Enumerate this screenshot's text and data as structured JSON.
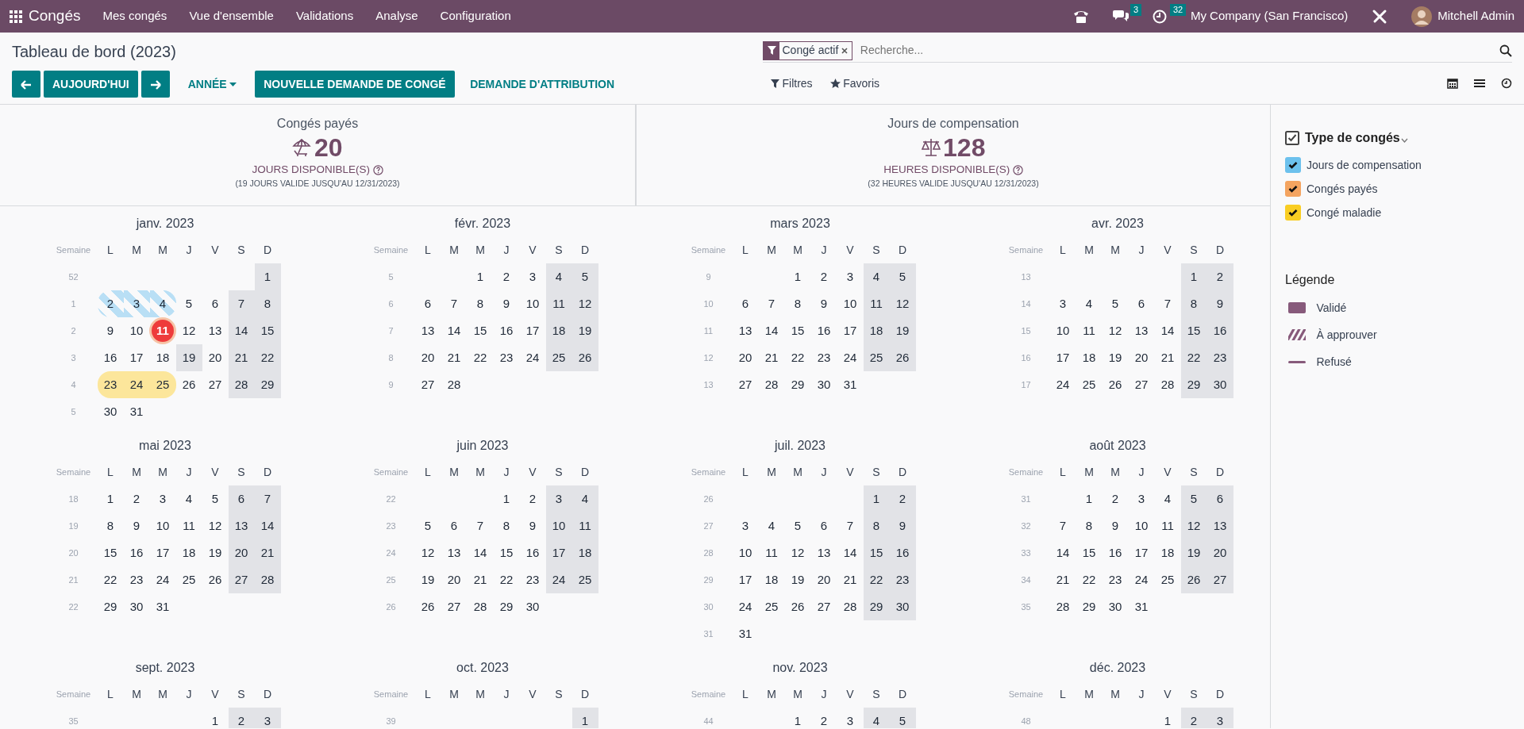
{
  "navbar": {
    "app": "Congés",
    "menu": [
      "Mes congés",
      "Vue d'ensemble",
      "Validations",
      "Analyse",
      "Configuration"
    ],
    "chat_count": "3",
    "activity_count": "32",
    "company": "My Company (San Francisco)",
    "user": "Mitchell Admin"
  },
  "breadcrumb": "Tableau de bord (2023)",
  "search": {
    "facet": "Congé actif",
    "placeholder": "Recherche..."
  },
  "toolbar": {
    "today": "AUJOURD'HUI",
    "period": "ANNÉE",
    "primary": "NOUVELLE DEMANDE DE CONGÉ",
    "secondary": "DEMANDE D'ATTRIBUTION",
    "filters": "Filtres",
    "favorites": "Favoris"
  },
  "views": [
    {
      "kind": "calendar"
    },
    {
      "kind": "list"
    },
    {
      "kind": "activity"
    }
  ],
  "summaries": [
    {
      "kind": "umbrella",
      "title": "Congés payés",
      "value": "20",
      "unit": "JOURS DISPONIBLE(S)",
      "note": "(19 JOURS VALIDE JUSQU'AU 12/31/2023)"
    },
    {
      "kind": "scale",
      "title": "Jours de compensation",
      "value": "128",
      "unit": "HEURES DISPONIBLE(S)",
      "note": "(32 HEURES VALIDE JUSQU'AU 12/31/2023)"
    }
  ],
  "calendar": {
    "weekend": [
      false,
      false,
      false,
      false,
      false,
      true,
      true
    ],
    "months": [
      {
        "title": "janv. 2023",
        "week_label": "Semaine",
        "weekdays": [
          "L",
          "M",
          "M",
          "J",
          "V",
          "S",
          "D"
        ],
        "weeks": [
          {
            "week": "52",
            "partial_start": true,
            "days": [
              "1"
            ]
          },
          {
            "week": "1",
            "days": [
              {
                "text": "2",
                "kind": "to_approve",
                "color": "#b9dff5"
              },
              {
                "text": "3",
                "kind": "to_approve",
                "color": "#b9dff5"
              },
              {
                "text": "4",
                "kind": "to_approve",
                "color": "#b9dff5"
              },
              "5",
              "6",
              "7",
              "8"
            ]
          },
          {
            "week": "2",
            "days": [
              "9",
              "10",
              {
                "text": "11",
                "today": true
              },
              "12",
              "13",
              "14",
              "15"
            ]
          },
          {
            "week": "3",
            "days": [
              "16",
              "17",
              "18",
              {
                "text": "19",
                "holiday": true
              },
              "20",
              "21",
              "22"
            ]
          },
          {
            "week": "4",
            "days": [
              {
                "text": "23",
                "kind": "validated",
                "color": "#fce69b"
              },
              {
                "text": "24",
                "kind": "validated",
                "color": "#fce69b"
              },
              {
                "text": "25",
                "kind": "validated",
                "color": "#fce69b"
              },
              "26",
              "27",
              "28",
              "29"
            ]
          },
          {
            "week": "5",
            "days": [
              "30",
              "31"
            ]
          }
        ]
      },
      {
        "title": "févr. 2023",
        "week_label": "Semaine",
        "weekdays": [
          "L",
          "M",
          "M",
          "J",
          "V",
          "S",
          "D"
        ],
        "weeks": [
          {
            "week": "5",
            "partial_start": true,
            "days": [
              "1",
              "2",
              "3",
              "4",
              "5"
            ]
          },
          {
            "week": "6",
            "days": [
              "6",
              "7",
              "8",
              "9",
              "10",
              "11",
              "12"
            ]
          },
          {
            "week": "7",
            "days": [
              "13",
              "14",
              "15",
              "16",
              "17",
              "18",
              "19"
            ]
          },
          {
            "week": "8",
            "days": [
              "20",
              "21",
              "22",
              "23",
              "24",
              "25",
              "26"
            ]
          },
          {
            "week": "9",
            "days": [
              "27",
              "28"
            ]
          }
        ]
      },
      {
        "title": "mars 2023",
        "week_label": "Semaine",
        "weekdays": [
          "L",
          "M",
          "M",
          "J",
          "V",
          "S",
          "D"
        ],
        "weeks": [
          {
            "week": "9",
            "partial_start": true,
            "days": [
              "1",
              "2",
              "3",
              "4",
              "5"
            ]
          },
          {
            "week": "10",
            "days": [
              "6",
              "7",
              "8",
              "9",
              "10",
              "11",
              "12"
            ]
          },
          {
            "week": "11",
            "days": [
              "13",
              "14",
              "15",
              "16",
              "17",
              "18",
              "19"
            ]
          },
          {
            "week": "12",
            "days": [
              "20",
              "21",
              "22",
              "23",
              "24",
              "25",
              "26"
            ]
          },
          {
            "week": "13",
            "days": [
              "27",
              "28",
              "29",
              "30",
              "31"
            ]
          }
        ]
      },
      {
        "title": "avr. 2023",
        "week_label": "Semaine",
        "weekdays": [
          "L",
          "M",
          "M",
          "J",
          "V",
          "S",
          "D"
        ],
        "weeks": [
          {
            "week": "13",
            "partial_start": true,
            "days": [
              "1",
              "2"
            ]
          },
          {
            "week": "14",
            "days": [
              "3",
              "4",
              "5",
              "6",
              "7",
              "8",
              "9"
            ]
          },
          {
            "week": "15",
            "days": [
              "10",
              "11",
              "12",
              "13",
              "14",
              "15",
              "16"
            ]
          },
          {
            "week": "16",
            "days": [
              "17",
              "18",
              "19",
              "20",
              "21",
              "22",
              "23"
            ]
          },
          {
            "week": "17",
            "days": [
              "24",
              "25",
              "26",
              "27",
              "28",
              "29",
              "30"
            ]
          }
        ]
      },
      {
        "title": "mai 2023",
        "week_label": "Semaine",
        "weekdays": [
          "L",
          "M",
          "M",
          "J",
          "V",
          "S",
          "D"
        ],
        "weeks": [
          {
            "week": "18",
            "days": [
              "1",
              "2",
              "3",
              "4",
              "5",
              "6",
              "7"
            ]
          },
          {
            "week": "19",
            "days": [
              "8",
              "9",
              "10",
              "11",
              "12",
              "13",
              "14"
            ]
          },
          {
            "week": "20",
            "days": [
              "15",
              "16",
              "17",
              "18",
              "19",
              "20",
              "21"
            ]
          },
          {
            "week": "21",
            "days": [
              "22",
              "23",
              "24",
              "25",
              "26",
              "27",
              "28"
            ]
          },
          {
            "week": "22",
            "days": [
              "29",
              "30",
              "31"
            ]
          }
        ]
      },
      {
        "title": "juin 2023",
        "week_label": "Semaine",
        "weekdays": [
          "L",
          "M",
          "M",
          "J",
          "V",
          "S",
          "D"
        ],
        "weeks": [
          {
            "week": "22",
            "partial_start": true,
            "days": [
              "1",
              "2",
              "3",
              "4"
            ]
          },
          {
            "week": "23",
            "days": [
              "5",
              "6",
              "7",
              "8",
              "9",
              "10",
              "11"
            ]
          },
          {
            "week": "24",
            "days": [
              "12",
              "13",
              "14",
              "15",
              "16",
              "17",
              "18"
            ]
          },
          {
            "week": "25",
            "days": [
              "19",
              "20",
              "21",
              "22",
              "23",
              "24",
              "25"
            ]
          },
          {
            "week": "26",
            "days": [
              "26",
              "27",
              "28",
              "29",
              "30"
            ]
          }
        ]
      },
      {
        "title": "juil. 2023",
        "week_label": "Semaine",
        "weekdays": [
          "L",
          "M",
          "M",
          "J",
          "V",
          "S",
          "D"
        ],
        "weeks": [
          {
            "week": "26",
            "partial_start": true,
            "days": [
              "1",
              "2"
            ]
          },
          {
            "week": "27",
            "days": [
              "3",
              "4",
              "5",
              "6",
              "7",
              "8",
              "9"
            ]
          },
          {
            "week": "28",
            "days": [
              "10",
              "11",
              "12",
              "13",
              "14",
              "15",
              "16"
            ]
          },
          {
            "week": "29",
            "days": [
              "17",
              "18",
              "19",
              "20",
              "21",
              "22",
              "23"
            ]
          },
          {
            "week": "30",
            "days": [
              "24",
              "25",
              "26",
              "27",
              "28",
              "29",
              "30"
            ]
          },
          {
            "week": "31",
            "days": [
              "31"
            ]
          }
        ]
      },
      {
        "title": "août 2023",
        "week_label": "Semaine",
        "weekdays": [
          "L",
          "M",
          "M",
          "J",
          "V",
          "S",
          "D"
        ],
        "weeks": [
          {
            "week": "31",
            "partial_start": true,
            "days": [
              "1",
              "2",
              "3",
              "4",
              "5",
              "6"
            ]
          },
          {
            "week": "32",
            "days": [
              "7",
              "8",
              "9",
              "10",
              "11",
              "12",
              "13"
            ]
          },
          {
            "week": "33",
            "days": [
              "14",
              "15",
              "16",
              "17",
              "18",
              "19",
              "20"
            ]
          },
          {
            "week": "34",
            "days": [
              "21",
              "22",
              "23",
              "24",
              "25",
              "26",
              "27"
            ]
          },
          {
            "week": "35",
            "days": [
              "28",
              "29",
              "30",
              "31"
            ]
          }
        ]
      },
      {
        "title": "sept. 2023",
        "week_label": "Semaine",
        "weekdays": [
          "L",
          "M",
          "M",
          "J",
          "V",
          "S",
          "D"
        ],
        "weeks": [
          {
            "week": "35",
            "partial_start": true,
            "days": [
              "1",
              "2",
              "3"
            ]
          }
        ]
      },
      {
        "title": "oct. 2023",
        "week_label": "Semaine",
        "weekdays": [
          "L",
          "M",
          "M",
          "J",
          "V",
          "S",
          "D"
        ],
        "weeks": [
          {
            "week": "39",
            "partial_start": true,
            "days": [
              "1"
            ]
          }
        ]
      },
      {
        "title": "nov. 2023",
        "week_label": "Semaine",
        "weekdays": [
          "L",
          "M",
          "M",
          "J",
          "V",
          "S",
          "D"
        ],
        "weeks": [
          {
            "week": "44",
            "partial_start": true,
            "days": [
              "1",
              "2",
              "3",
              "4",
              "5"
            ]
          }
        ]
      },
      {
        "title": "déc. 2023",
        "week_label": "Semaine",
        "weekdays": [
          "L",
          "M",
          "M",
          "J",
          "V",
          "S",
          "D"
        ],
        "weeks": [
          {
            "week": "48",
            "partial_start": true,
            "days": [
              "1",
              "2",
              "3"
            ]
          }
        ]
      }
    ]
  },
  "filter": {
    "title": "Type de congés",
    "checked": true,
    "items": [
      {
        "label": "Jours de compensation",
        "checked": true,
        "color": "#6cc1ed"
      },
      {
        "label": "Congés payés",
        "checked": true,
        "color": "#f4a460"
      },
      {
        "label": "Congé maladie",
        "checked": true,
        "color": "#f9cd23"
      }
    ]
  },
  "legend": {
    "title": "Légende",
    "items": [
      {
        "kind": "validated",
        "label": "Validé"
      },
      {
        "kind": "to_approve",
        "label": "À approuver"
      },
      {
        "kind": "refused",
        "label": "Refusé"
      }
    ]
  }
}
